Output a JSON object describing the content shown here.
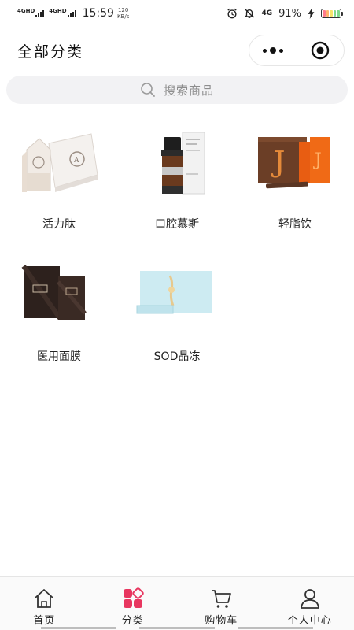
{
  "status_bar": {
    "sim1": "4GHD",
    "sim2": "4GHD",
    "time": "15:59",
    "speed_value": "120",
    "speed_unit": "KB/s",
    "network": "4G",
    "battery": "91%",
    "icons": [
      "alarm-icon",
      "mute-bell-icon",
      "charging-bolt-icon",
      "battery-icon"
    ]
  },
  "header": {
    "title": "全部分类",
    "menu_icon": "more-dots-icon",
    "close_icon": "target-circle-icon"
  },
  "search": {
    "placeholder": "搜索商品",
    "icon": "search-icon"
  },
  "categories": [
    {
      "label": "活力肽",
      "icon": "product-peptide-image"
    },
    {
      "label": "口腔慕斯",
      "icon": "product-mousse-image"
    },
    {
      "label": "轻脂饮",
      "icon": "product-drink-image"
    },
    {
      "label": "医用面膜",
      "icon": "product-mask-image"
    },
    {
      "label": "SOD晶冻",
      "icon": "product-jelly-image"
    }
  ],
  "tabbar": {
    "items": [
      {
        "label": "首页",
        "icon": "home-icon"
      },
      {
        "label": "分类",
        "icon": "category-icon",
        "active": true
      },
      {
        "label": "购物车",
        "icon": "cart-icon"
      },
      {
        "label": "个人中心",
        "icon": "person-icon"
      }
    ],
    "active_color": "#e8365f"
  }
}
